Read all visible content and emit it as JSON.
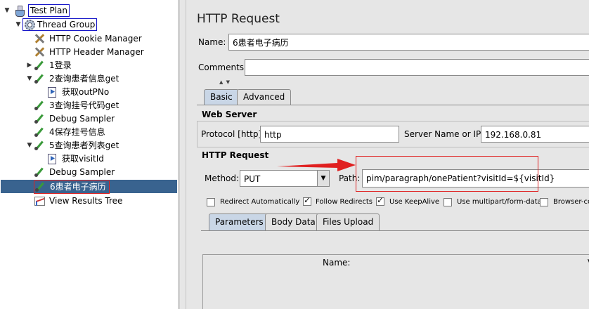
{
  "tree": {
    "items": [
      {
        "label": "Test Plan",
        "icon": "flask-icon",
        "toggle": "▼"
      },
      {
        "label": "Thread Group",
        "icon": "gear-icon",
        "toggle": "▼"
      },
      {
        "label": "HTTP Cookie Manager",
        "icon": "tools-icon",
        "toggle": ""
      },
      {
        "label": "HTTP Header Manager",
        "icon": "tools-icon",
        "toggle": ""
      },
      {
        "label": "1登录",
        "icon": "dropper-icon",
        "toggle": "▶"
      },
      {
        "label": "2查询患者信息get",
        "icon": "dropper-icon",
        "toggle": "▼"
      },
      {
        "label": "获取outPNo",
        "icon": "extractor-icon",
        "toggle": ""
      },
      {
        "label": "3查询挂号代码get",
        "icon": "dropper-icon",
        "toggle": ""
      },
      {
        "label": "Debug Sampler",
        "icon": "dropper-icon",
        "toggle": ""
      },
      {
        "label": "4保存挂号信息",
        "icon": "dropper-icon",
        "toggle": ""
      },
      {
        "label": "5查询患者列表get",
        "icon": "dropper-icon",
        "toggle": "▼"
      },
      {
        "label": "获取visitId",
        "icon": "extractor-icon",
        "toggle": ""
      },
      {
        "label": "Debug Sampler",
        "icon": "dropper-icon",
        "toggle": ""
      },
      {
        "label": "6患者电子病历",
        "icon": "dropper-icon",
        "toggle": ""
      },
      {
        "label": "View Results Tree",
        "icon": "chart-icon",
        "toggle": ""
      }
    ]
  },
  "panel": {
    "title": "HTTP Request",
    "name_label": "Name:",
    "name_value": "6患者电子病历",
    "comments_label": "Comments:",
    "comments_value": "",
    "splitter": "▲ ▼",
    "tabs": [
      "Basic",
      "Advanced"
    ],
    "web_server": {
      "title": "Web Server",
      "protocol_label": "Protocol [http]:",
      "protocol_value": "http",
      "server_label": "Server Name or IP:",
      "server_value": "192.168.0.81"
    },
    "http_request": {
      "title": "HTTP Request",
      "method_label": "Method:",
      "method_value": "PUT",
      "path_label": "Path:",
      "path_value": "pim/paragraph/onePatient?visitId=${visitId}"
    },
    "options": [
      {
        "label": "Redirect Automatically",
        "checked": false
      },
      {
        "label": "Follow Redirects",
        "checked": true
      },
      {
        "label": "Use KeepAlive",
        "checked": true
      },
      {
        "label": "Use multipart/form-data",
        "checked": false
      },
      {
        "label": "Browser-co",
        "checked": false
      }
    ],
    "subtabs": [
      "Parameters",
      "Body Data",
      "Files Upload"
    ],
    "table": {
      "name_header": "Name:",
      "value_header_partial": "V"
    }
  },
  "colors": {
    "selection": "#39638f",
    "annotation_red": "#e02020",
    "tree_box_blue": "#1515c8"
  }
}
